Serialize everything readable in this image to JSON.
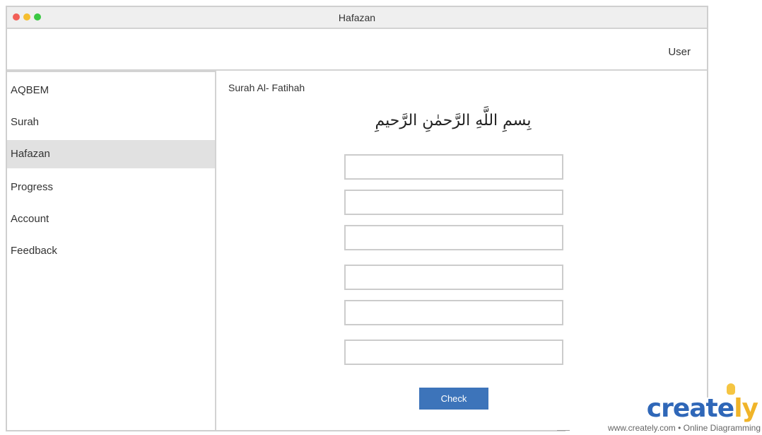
{
  "window": {
    "title": "Hafazan",
    "controls": [
      {
        "name": "close",
        "color": "#f25f58"
      },
      {
        "name": "minimize",
        "color": "#f5be30"
      },
      {
        "name": "maximize",
        "color": "#3ac843"
      }
    ]
  },
  "header": {
    "user_label": "User"
  },
  "sidebar": {
    "items": [
      {
        "label": "AQBEM",
        "active": false
      },
      {
        "label": "Surah",
        "active": false
      },
      {
        "label": "Hafazan",
        "active": true
      },
      {
        "label": "Progress",
        "active": false
      },
      {
        "label": "Account",
        "active": false
      },
      {
        "label": "Feedback",
        "active": false
      }
    ]
  },
  "main": {
    "surah_title": "Surah Al- Fatihah",
    "verse": "بِسمِ اللَّهِ الرَّحمٰنِ الرَّحيمِ",
    "inputs": [
      {
        "value": "",
        "placeholder": ""
      },
      {
        "value": "",
        "placeholder": ""
      },
      {
        "value": "",
        "placeholder": ""
      },
      {
        "value": "",
        "placeholder": ""
      },
      {
        "value": "",
        "placeholder": ""
      },
      {
        "value": "",
        "placeholder": ""
      }
    ],
    "check_label": "Check"
  },
  "watermark": {
    "logo_main": "creat",
    "logo_accent": "ly",
    "logo_e": "e",
    "tagline": "www.creately.com • Online Diagramming"
  },
  "colors": {
    "accent": "#3d74ba",
    "active_nav": "#e1e1e1",
    "border": "#d3d3d3"
  }
}
